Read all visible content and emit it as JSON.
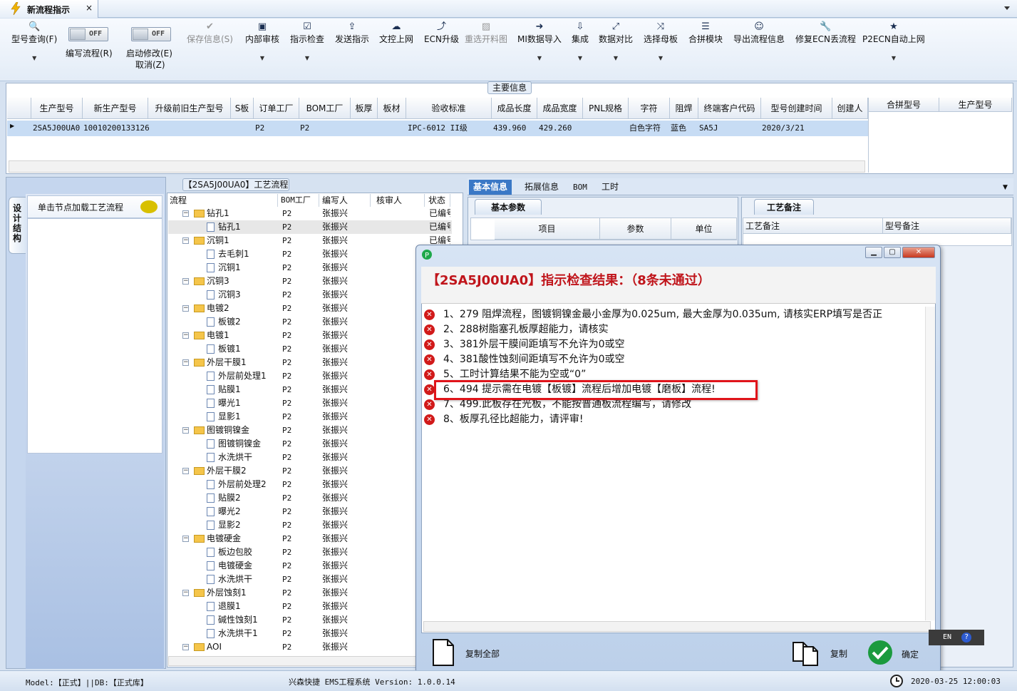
{
  "window": {
    "tab_title": "新流程指示",
    "close_glyph": "×"
  },
  "toolbar": {
    "items": [
      {
        "label": "型号查询(F)",
        "icon": "search-icon",
        "dd": true
      },
      {
        "label": "保存信息(S)",
        "icon": "check-icon",
        "disabled": true
      },
      {
        "label": "内部审核",
        "icon": "print-icon",
        "dd": true
      },
      {
        "label": "指示检查",
        "icon": "checkbox-icon",
        "dd": true
      },
      {
        "label": "发送指示",
        "icon": "upload-icon"
      },
      {
        "label": "文控上网",
        "icon": "cloud-upload-icon"
      },
      {
        "label": "ECN升级",
        "icon": "upgrade-icon"
      },
      {
        "label": "重选开料图",
        "icon": "image-icon",
        "disabled": true
      },
      {
        "label": "MI数据导入",
        "icon": "import-icon",
        "dd": true
      },
      {
        "label": "集成",
        "icon": "download-icon",
        "dd": true
      },
      {
        "label": "数据对比",
        "icon": "compare-icon",
        "dd": true
      },
      {
        "label": "选择母板",
        "icon": "shuffle-icon",
        "dd": true
      },
      {
        "label": "合拼模块",
        "icon": "list-icon"
      },
      {
        "label": "导出流程信息",
        "icon": "smile-icon"
      },
      {
        "label": "修复ECN丢流程",
        "icon": "wrench-icon"
      },
      {
        "label": "P2ECN自动上网",
        "icon": "star-icon",
        "dd": true
      }
    ],
    "toggle_off": "OFF",
    "write_flow": "编写流程(R)",
    "start_modify": "启动修改(E)",
    "cancel": "取消(Z)"
  },
  "main_info": {
    "label": "主要信息",
    "headers": [
      "生产型号",
      "新生产型号",
      "升级前旧生产型号",
      "S板",
      "订单工厂",
      "BOM工厂",
      "板厚",
      "板材",
      "验收标准",
      "成品长度",
      "成品宽度",
      "PNL规格",
      "字符",
      "阻焊",
      "终端客户代码",
      "型号创建时间",
      "创建人"
    ],
    "row": [
      "2SA5J00UA0",
      "10010200133126",
      "",
      "",
      "P2",
      "P2",
      "",
      "",
      "IPC-6012 II级",
      "439.960",
      "429.260",
      "",
      "白色字符",
      "蓝色",
      "SA5J",
      "2020/3/21",
      ""
    ],
    "merge_headers": [
      "合拼型号",
      "生产型号"
    ]
  },
  "left_panel": {
    "vtab": "设计结构",
    "header": "单击节点加载工艺流程"
  },
  "tree": {
    "title": "【2SA5J00UA0】工艺流程",
    "headers": [
      "流程",
      "BOM工厂",
      "编写人",
      "核审人",
      "状态"
    ],
    "rows": [
      {
        "name": "钻孔1",
        "level": 1,
        "bom": "P2",
        "author": "张振兴",
        "status": "已编号"
      },
      {
        "name": "钻孔1",
        "level": 2,
        "bom": "P2",
        "author": "张振兴",
        "status": "已编号",
        "sel": true
      },
      {
        "name": "沉铜1",
        "level": 1,
        "bom": "P2",
        "author": "张振兴",
        "status": "已编号"
      },
      {
        "name": "去毛刺1",
        "level": 2,
        "bom": "P2",
        "author": "张振兴",
        "status": ""
      },
      {
        "name": "沉铜1",
        "level": 2,
        "bom": "P2",
        "author": "张振兴",
        "status": ""
      },
      {
        "name": "沉铜3",
        "level": 1,
        "bom": "P2",
        "author": "张振兴",
        "status": ""
      },
      {
        "name": "沉铜3",
        "level": 2,
        "bom": "P2",
        "author": "张振兴",
        "status": ""
      },
      {
        "name": "电镀2",
        "level": 1,
        "bom": "P2",
        "author": "张振兴",
        "status": ""
      },
      {
        "name": "板镀2",
        "level": 2,
        "bom": "P2",
        "author": "张振兴",
        "status": ""
      },
      {
        "name": "电镀1",
        "level": 1,
        "bom": "P2",
        "author": "张振兴",
        "status": ""
      },
      {
        "name": "板镀1",
        "level": 2,
        "bom": "P2",
        "author": "张振兴",
        "status": ""
      },
      {
        "name": "外层干膜1",
        "level": 1,
        "bom": "P2",
        "author": "张振兴",
        "status": ""
      },
      {
        "name": "外层前处理1",
        "level": 2,
        "bom": "P2",
        "author": "张振兴",
        "status": ""
      },
      {
        "name": "贴膜1",
        "level": 2,
        "bom": "P2",
        "author": "张振兴",
        "status": ""
      },
      {
        "name": "曝光1",
        "level": 2,
        "bom": "P2",
        "author": "张振兴",
        "status": ""
      },
      {
        "name": "显影1",
        "level": 2,
        "bom": "P2",
        "author": "张振兴",
        "status": ""
      },
      {
        "name": "图镀铜镍金",
        "level": 1,
        "bom": "P2",
        "author": "张振兴",
        "status": ""
      },
      {
        "name": "图镀铜镍金",
        "level": 2,
        "bom": "P2",
        "author": "张振兴",
        "status": ""
      },
      {
        "name": "水洗烘干",
        "level": 2,
        "bom": "P2",
        "author": "张振兴",
        "status": ""
      },
      {
        "name": "外层干膜2",
        "level": 1,
        "bom": "P2",
        "author": "张振兴",
        "status": ""
      },
      {
        "name": "外层前处理2",
        "level": 2,
        "bom": "P2",
        "author": "张振兴",
        "status": ""
      },
      {
        "name": "贴膜2",
        "level": 2,
        "bom": "P2",
        "author": "张振兴",
        "status": ""
      },
      {
        "name": "曝光2",
        "level": 2,
        "bom": "P2",
        "author": "张振兴",
        "status": ""
      },
      {
        "name": "显影2",
        "level": 2,
        "bom": "P2",
        "author": "张振兴",
        "status": ""
      },
      {
        "name": "电镀硬金",
        "level": 1,
        "bom": "P2",
        "author": "张振兴",
        "status": ""
      },
      {
        "name": "板边包胶",
        "level": 2,
        "bom": "P2",
        "author": "张振兴",
        "status": ""
      },
      {
        "name": "电镀硬金",
        "level": 2,
        "bom": "P2",
        "author": "张振兴",
        "status": ""
      },
      {
        "name": "水洗烘干",
        "level": 2,
        "bom": "P2",
        "author": "张振兴",
        "status": ""
      },
      {
        "name": "外层蚀刻1",
        "level": 1,
        "bom": "P2",
        "author": "张振兴",
        "status": ""
      },
      {
        "name": "退膜1",
        "level": 2,
        "bom": "P2",
        "author": "张振兴",
        "status": ""
      },
      {
        "name": "碱性蚀刻1",
        "level": 2,
        "bom": "P2",
        "author": "张振兴",
        "status": ""
      },
      {
        "name": "水洗烘干1",
        "level": 2,
        "bom": "P2",
        "author": "张振兴",
        "status": ""
      },
      {
        "name": "AOI",
        "level": 1,
        "bom": "P2",
        "author": "张振兴",
        "status": ""
      }
    ]
  },
  "right": {
    "tabs": [
      "基本信息",
      "拓展信息",
      "BOM",
      "工时"
    ],
    "basic_tab": "基本参数",
    "basic_headers": [
      "项目",
      "参数",
      "单位"
    ],
    "notes_tab": "工艺备注",
    "notes_headers": [
      "工艺备注",
      "型号备注"
    ]
  },
  "dialog": {
    "title": "【2SA5J00UA0】指示检查结果：（8条未通过）",
    "errors": [
      "1、279 阻焊流程，图镀铜镍金最小金厚为0.025um, 最大金厚为0.035um, 请核实ERP填写是否正",
      "2、288树脂塞孔板厚超能力，请核实",
      "3、381外层干膜间距填写不允许为0或空",
      "4、381酸性蚀刻间距填写不允许为0或空",
      "5、工时计算结果不能为空或“0”",
      "6、494 提示需在电镀【板镀】流程后增加电镀【磨板】流程!",
      "7、499.此板存在光板，不能按普通板流程编写，请修改",
      "8、板厚孔径比超能力，请评审!"
    ],
    "copy_all": "复制全部",
    "copy": "复制",
    "ok": "确定"
  },
  "status": {
    "left": "Model:【正式】||DB:【正式库】",
    "center": "兴森快捷 EMS工程系统 Version: 1.0.0.14",
    "time": "2020-03-25 12:00:03",
    "lang": "EN"
  }
}
